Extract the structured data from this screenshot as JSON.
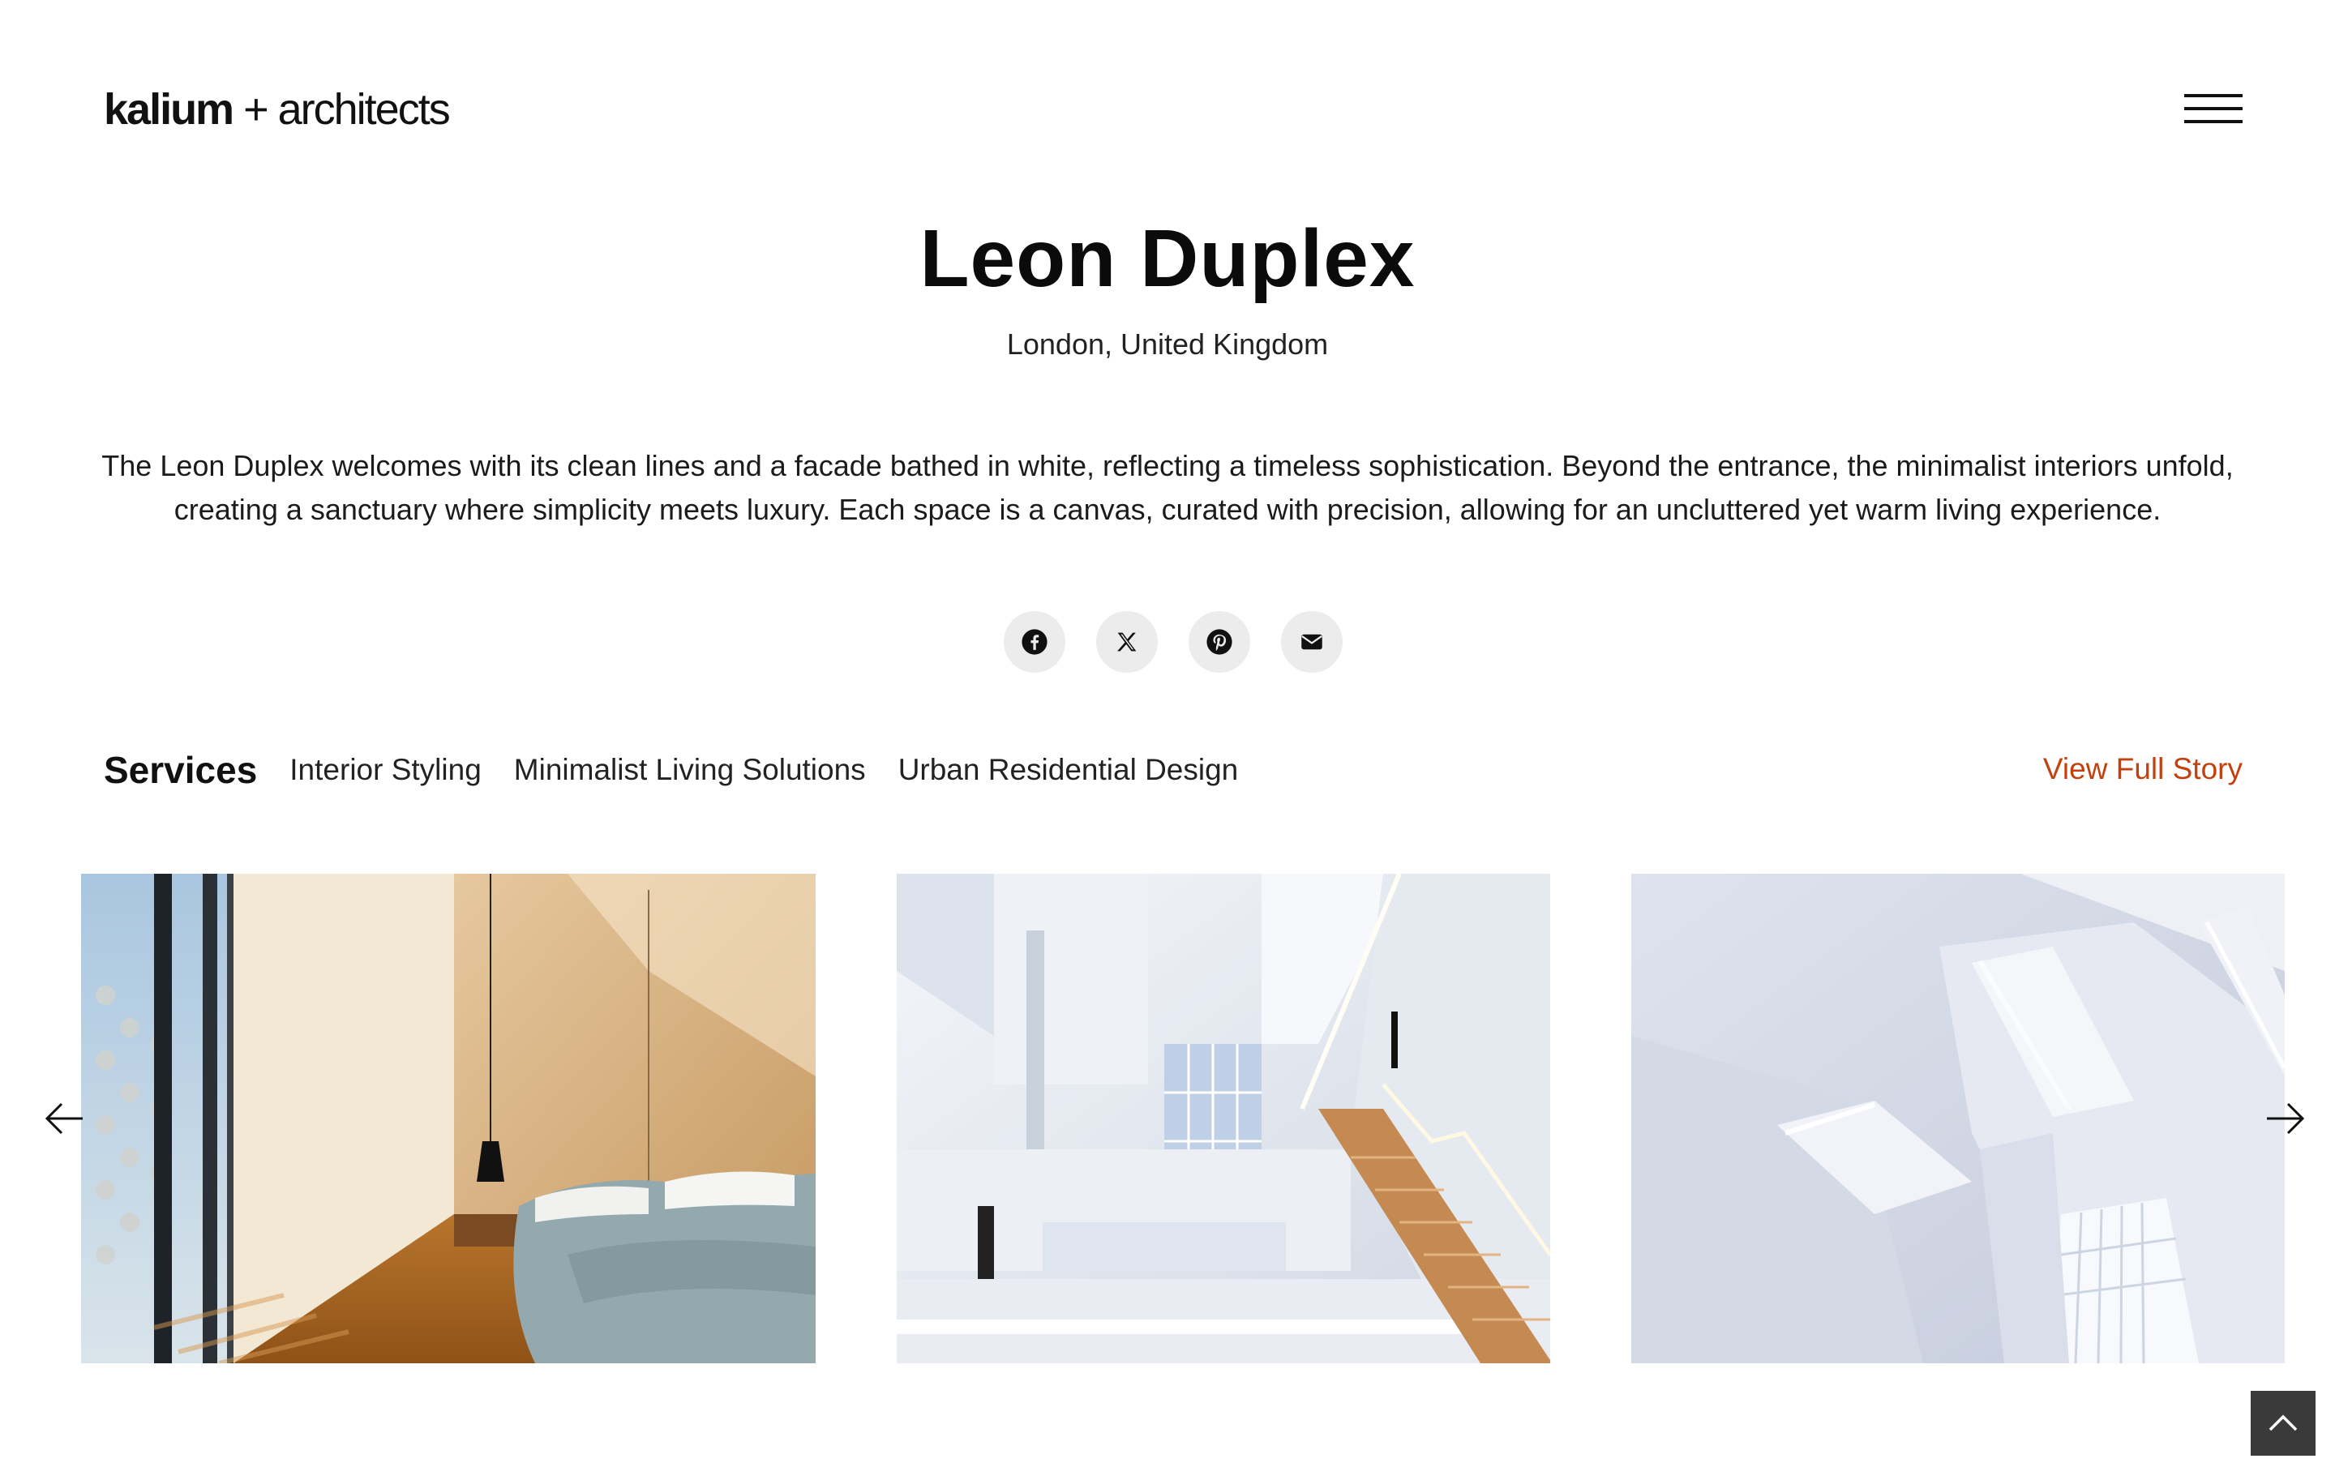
{
  "header": {
    "logo_brand": "kalium",
    "logo_rest": " + architects",
    "menu_icon": "hamburger-icon"
  },
  "project": {
    "title": "Leon Duplex",
    "location": "London, United Kingdom",
    "description": "The Leon Duplex welcomes with its clean lines and a facade bathed in white, reflecting a timeless sophistication. Beyond the entrance, the minimalist interiors unfold, creating a sanctuary where simplicity meets luxury. Each space is a canvas, curated with precision, allowing for an uncluttered yet warm living experience."
  },
  "social": [
    {
      "icon": "facebook-icon"
    },
    {
      "icon": "x-icon"
    },
    {
      "icon": "pinterest-icon"
    },
    {
      "icon": "email-icon"
    }
  ],
  "services": {
    "label": "Services",
    "items": [
      "Interior Styling",
      "Minimalist Living Solutions",
      "Urban Residential Design"
    ],
    "link_label": "View Full Story",
    "link_color": "#c2410c"
  },
  "gallery": {
    "prev_icon": "arrow-left-icon",
    "next_icon": "arrow-right-icon",
    "images": [
      {
        "subject": "bedroom-with-wood-floor"
      },
      {
        "subject": "white-atrium-with-stairs"
      },
      {
        "subject": "white-ceiling-skylight"
      }
    ]
  },
  "back_to_top_icon": "chevron-up-icon"
}
